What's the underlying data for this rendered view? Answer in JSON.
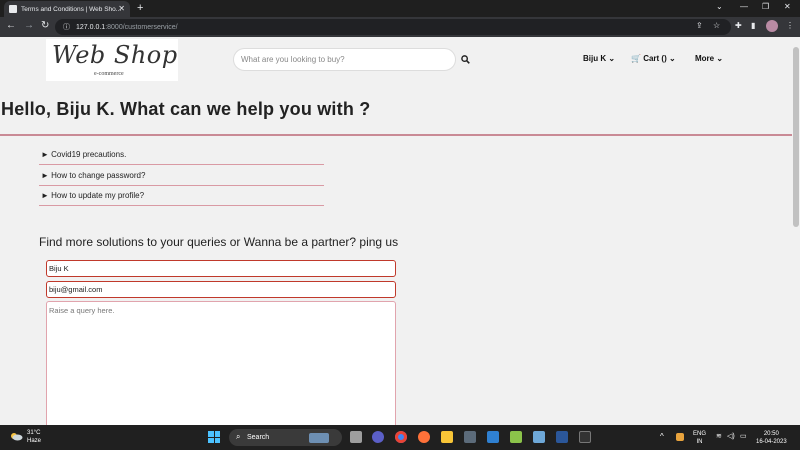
{
  "browser": {
    "tab_title": "Terms and Conditions | Web Sho...",
    "url_host": "127.0.0.1",
    "url_path": ":8000/customerservice/"
  },
  "header": {
    "logo_text": "Web Shop",
    "logo_subtext": "e-commerce",
    "search_placeholder": "What are you looking to buy?",
    "user_label": "Biju K",
    "cart_label": "Cart ()",
    "more_label": "More"
  },
  "main": {
    "greeting": "Hello, Biju K. What can we help you with ?",
    "faqs": [
      {
        "label": "► Covid19 precautions."
      },
      {
        "label": "► How to change password?"
      },
      {
        "label": "► How to update my profile?"
      }
    ],
    "contact_heading": "Find more solutions to your queries or Wanna be a partner? ping us",
    "form": {
      "name_value": "Biju K",
      "email_value": "biju@gmail.com",
      "query_placeholder": "Raise a query here."
    }
  },
  "taskbar": {
    "weather_temp": "31°C",
    "weather_desc": "Haze",
    "search_label": "Search",
    "lang_line1": "ENG",
    "lang_line2": "IN",
    "time": "20:50",
    "date": "16-04-2023"
  },
  "colors": {
    "accent_rule": "#c98a95",
    "field_border": "#c0392b"
  }
}
